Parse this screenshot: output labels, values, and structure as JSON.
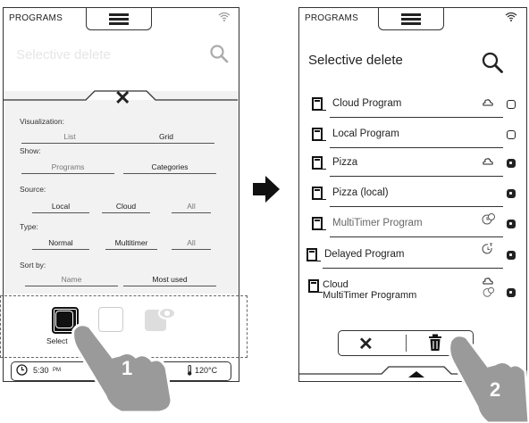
{
  "left_screen": {
    "topbar_title": "PROGRAMS",
    "header_title": "Selective delete",
    "filters": [
      {
        "label": "Visualization:",
        "options": [
          "List",
          "Grid"
        ]
      },
      {
        "label": "Show:",
        "options": [
          "Programs",
          "Categories"
        ]
      },
      {
        "label": "Source:",
        "options": [
          "Local",
          "Cloud",
          "All"
        ]
      },
      {
        "label": "Type:",
        "options": [
          "Normal",
          "Multitimer",
          "All"
        ]
      },
      {
        "label": "Sort by:",
        "options": [
          "Name",
          "Most used"
        ]
      }
    ],
    "action_label": "Select",
    "status": {
      "time": "5:30",
      "time_suffix": "PM",
      "temperature": "120°C"
    }
  },
  "right_screen": {
    "topbar_title": "PROGRAMS",
    "header_title": "Selective delete",
    "programs": [
      {
        "name": "Cloud Program",
        "badge": "cloud-icon",
        "checked": false
      },
      {
        "name": "Local Program",
        "badge": "",
        "checked": false
      },
      {
        "name": "Pizza",
        "badge": "cloud-icon",
        "checked": true
      },
      {
        "name": "Pizza (local)",
        "badge": "",
        "checked": true
      },
      {
        "name": "MultiTimer Program",
        "badge": "multitimer-icon",
        "checked": true
      },
      {
        "name": "Delayed Program",
        "badge": "delay-icon",
        "checked": true
      },
      {
        "name_line1": "Cloud",
        "name_line2": "MultiTimer Programm",
        "badge": "cloud-multitimer-icon",
        "checked": true
      }
    ]
  },
  "callouts": {
    "step1": "1",
    "step2": "2"
  },
  "colors": {
    "panel": "#f2f2f2",
    "ink": "#222222",
    "hand": "#9a9a9a"
  }
}
